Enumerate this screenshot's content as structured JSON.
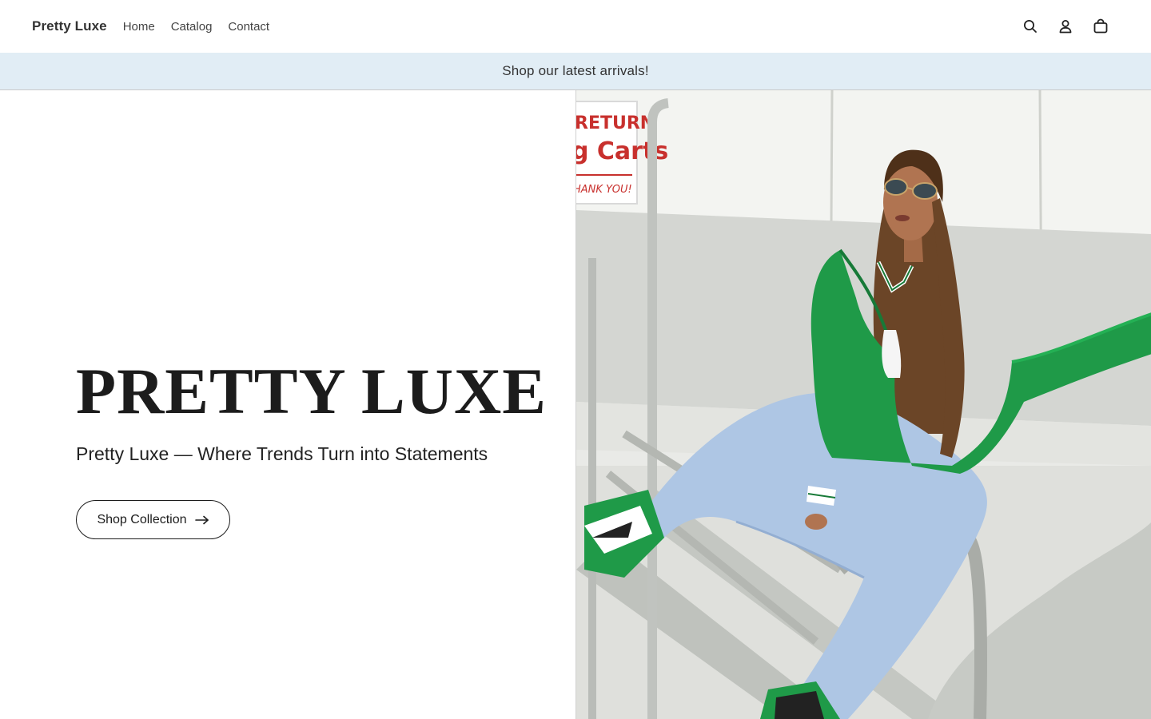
{
  "header": {
    "brand": "Pretty Luxe",
    "nav": [
      {
        "label": "Home"
      },
      {
        "label": "Catalog"
      },
      {
        "label": "Contact"
      }
    ],
    "icons": [
      "search-icon",
      "account-icon",
      "cart-icon"
    ]
  },
  "announcement": {
    "text": "Shop our latest arrivals!",
    "background": "#e1edf5"
  },
  "hero": {
    "title": "PRETTY LUXE",
    "subtitle": "Pretty Luxe — Where Trends Turn into Statements",
    "button_label": "Shop Collection",
    "photo_sign_lines": [
      "RETURN",
      "g Carts",
      "HANK YOU!"
    ]
  },
  "colors": {
    "jacket": "#1f9a48",
    "jeans": "#aec6e4",
    "text": "#1c1c1c"
  }
}
